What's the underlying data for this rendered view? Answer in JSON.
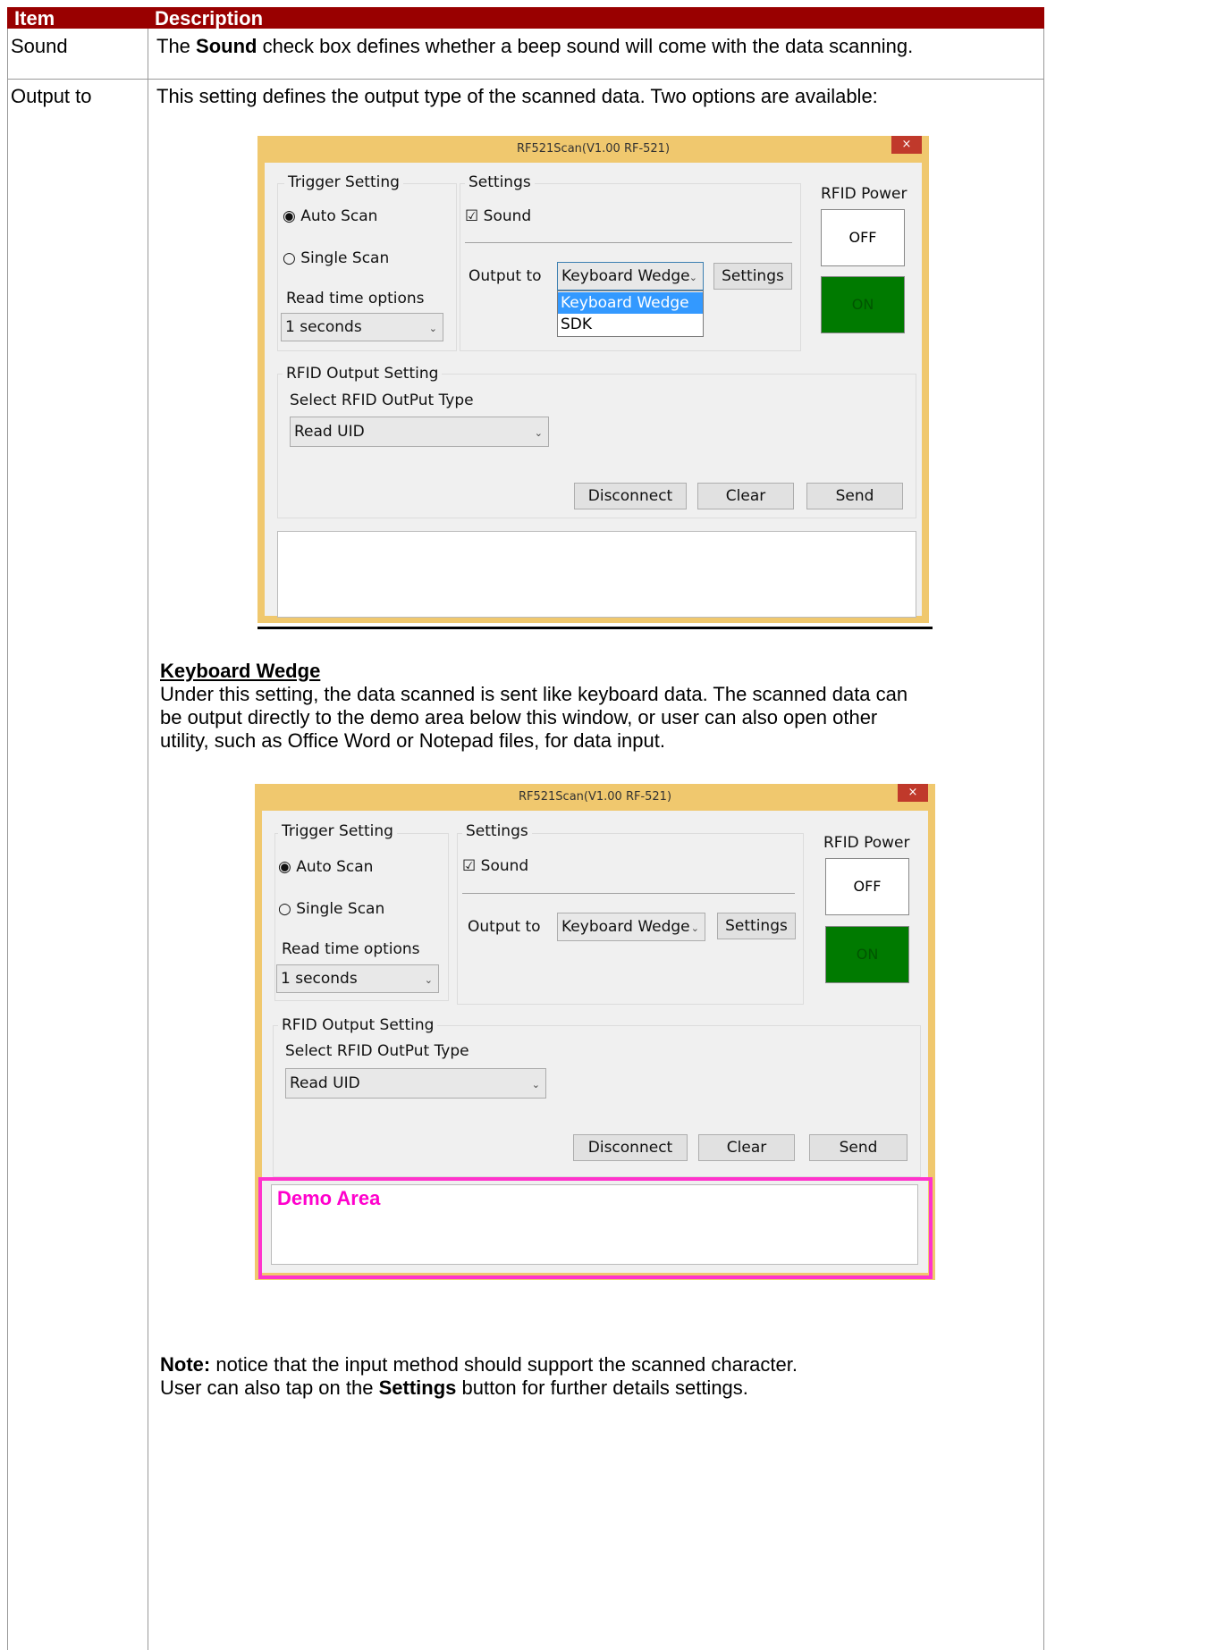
{
  "table": {
    "header": {
      "item": "Item",
      "description": "Description"
    },
    "rows": [
      {
        "item": "Sound",
        "desc_pre": "The ",
        "desc_bold": "Sound",
        "desc_post": " check box defines whether a beep sound will come with the data scanning."
      },
      {
        "item": "Output to",
        "desc": "This setting defines the output type of the scanned data. Two options are available:"
      }
    ]
  },
  "window": {
    "title": "RF521Scan(V1.00 RF-521)",
    "close": "×",
    "trigger_setting": "Trigger Setting",
    "auto_scan": "Auto Scan",
    "single_scan": "Single Scan",
    "read_time_options": "Read time options",
    "read_time_value": "1 seconds",
    "settings_group": "Settings",
    "sound": "Sound",
    "output_to": "Output to",
    "output_value": "Keyboard Wedge",
    "settings_button": "Settings",
    "rfid_power": "RFID Power",
    "off": "OFF",
    "on": "ON",
    "rfid_output_setting": "RFID Output Setting",
    "select_rfid_output_type": "Select RFID OutPut Type",
    "read_uid": "Read UID",
    "disconnect": "Disconnect",
    "clear": "Clear",
    "send": "Send",
    "dropdown_options": [
      "Keyboard Wedge",
      "SDK"
    ]
  },
  "keyboard_wedge": {
    "heading": "Keyboard Wedge",
    "lines": [
      "Under this setting, the data scanned is sent like keyboard data. The scanned data can",
      "be output directly to the demo area below this window, or user can also open other",
      "utility, such as Office Word or Notepad files, for data input."
    ]
  },
  "demo_area": "Demo Area",
  "note": {
    "label": "Note:",
    "line1": " notice that the input method should support the scanned character.",
    "line2_pre": "User can also tap on the ",
    "line2_bold": "Settings",
    "line2_post": " button for further details settings."
  },
  "colors": {
    "header_bg": "#990000",
    "window_border": "#f0c86e",
    "on_green": "#007a00",
    "demo_magenta": "#ff00cc"
  },
  "icons": {
    "radio_checked": "◉",
    "radio_empty": "○",
    "checkbox_checked": "☑",
    "combo_arrow": "⌄"
  }
}
